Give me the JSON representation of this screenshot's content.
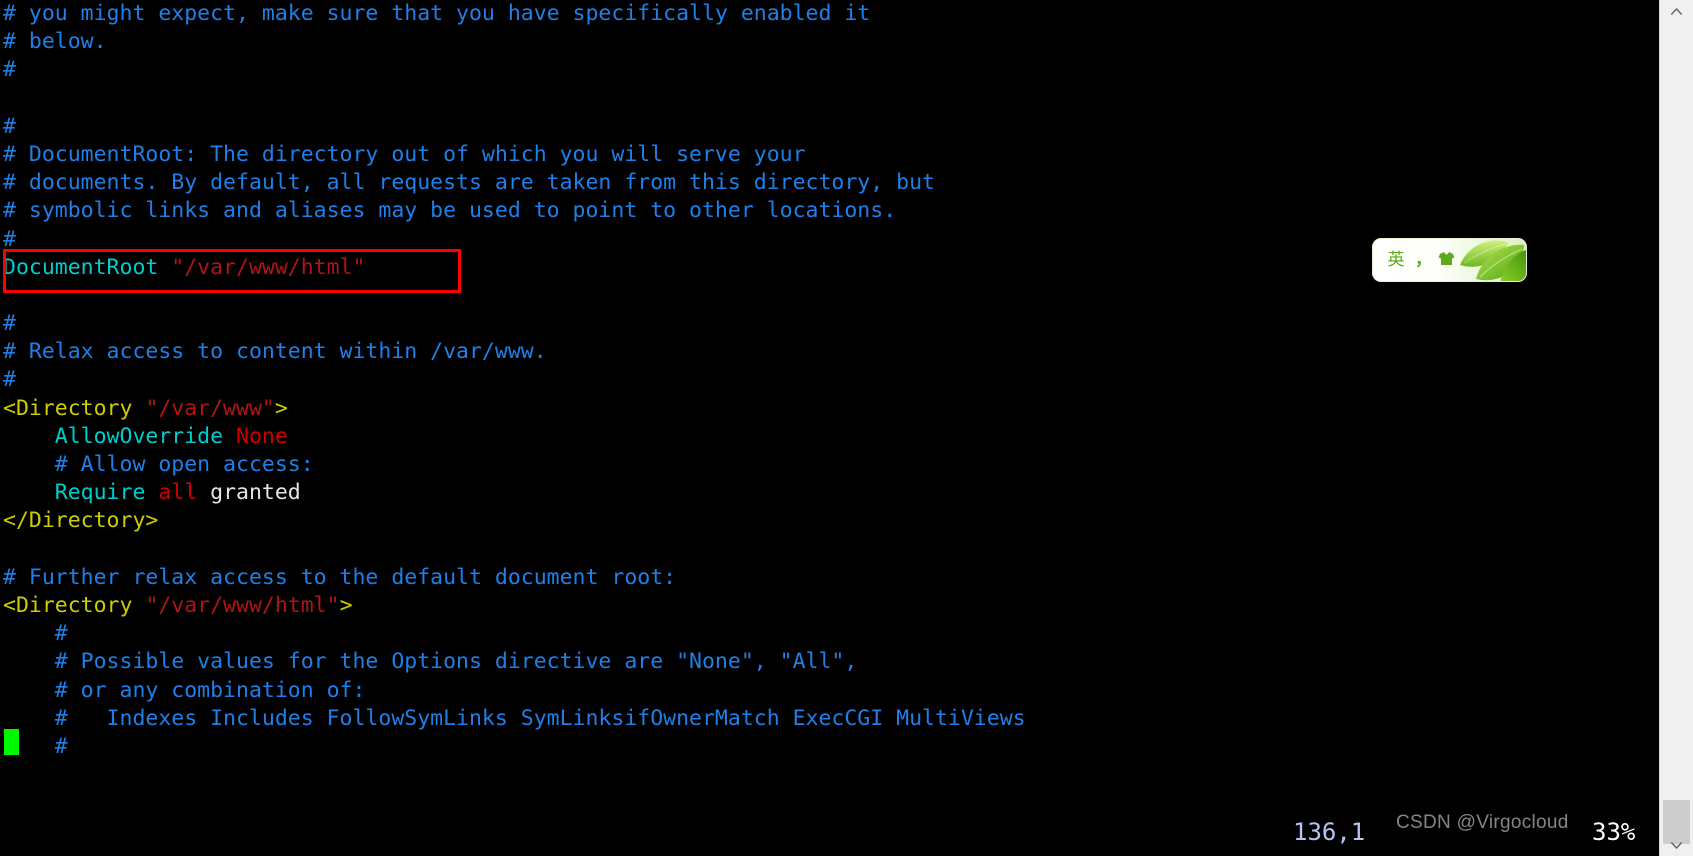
{
  "window": {
    "kind": "terminal-editor",
    "background_color": "#000000"
  },
  "editor": {
    "file_type": "apache-httpd-conf",
    "colors": {
      "comment": "#1f7fe8",
      "directive": "#00cdcd",
      "string": "#b01414",
      "value": "#cd0000",
      "tag": "#cdcd00",
      "plain": "#e6e6e6",
      "cursor": "#00f700",
      "highlight_box": "#ff0000"
    },
    "lines": [
      {
        "id": "l01",
        "segments": [
          {
            "style": "comment",
            "text": "# you might expect, make sure that you have specifically enabled it"
          }
        ]
      },
      {
        "id": "l02",
        "segments": [
          {
            "style": "comment",
            "text": "# below."
          }
        ]
      },
      {
        "id": "l03",
        "segments": [
          {
            "style": "comment",
            "text": "#"
          }
        ]
      },
      {
        "id": "l04",
        "segments": [
          {
            "style": "blank",
            "text": ""
          }
        ]
      },
      {
        "id": "l05",
        "segments": [
          {
            "style": "comment",
            "text": "#"
          }
        ]
      },
      {
        "id": "l06",
        "segments": [
          {
            "style": "comment",
            "text": "# DocumentRoot: The directory out of which you will serve your"
          }
        ]
      },
      {
        "id": "l07",
        "segments": [
          {
            "style": "comment",
            "text": "# documents. By default, all requests are taken from this directory, but"
          }
        ]
      },
      {
        "id": "l08",
        "segments": [
          {
            "style": "comment",
            "text": "# symbolic links and aliases may be used to point to other locations."
          }
        ]
      },
      {
        "id": "l09",
        "segments": [
          {
            "style": "comment",
            "text": "#"
          }
        ]
      },
      {
        "id": "l10",
        "segments": [
          {
            "style": "keyword",
            "text": "DocumentRoot "
          },
          {
            "style": "string",
            "text": "\"/var/www/html\""
          }
        ]
      },
      {
        "id": "l11",
        "segments": [
          {
            "style": "blank",
            "text": ""
          }
        ]
      },
      {
        "id": "l12",
        "segments": [
          {
            "style": "comment",
            "text": "#"
          }
        ]
      },
      {
        "id": "l13",
        "segments": [
          {
            "style": "comment",
            "text": "# Relax access to content within /var/www."
          }
        ]
      },
      {
        "id": "l14",
        "segments": [
          {
            "style": "comment",
            "text": "#"
          }
        ]
      },
      {
        "id": "l15",
        "segments": [
          {
            "style": "tag",
            "text": "<Directory "
          },
          {
            "style": "string",
            "text": "\"/var/www\""
          },
          {
            "style": "tag",
            "text": ">"
          }
        ]
      },
      {
        "id": "l16",
        "segments": [
          {
            "style": "keyword",
            "text": "    AllowOverride "
          },
          {
            "style": "value",
            "text": "None"
          }
        ]
      },
      {
        "id": "l17",
        "segments": [
          {
            "style": "comment",
            "text": "    # Allow open access:"
          }
        ]
      },
      {
        "id": "l18",
        "segments": [
          {
            "style": "keyword",
            "text": "    Require "
          },
          {
            "style": "value",
            "text": "all "
          },
          {
            "style": "plain",
            "text": "granted"
          }
        ]
      },
      {
        "id": "l19",
        "segments": [
          {
            "style": "tag",
            "text": "</Directory>"
          }
        ]
      },
      {
        "id": "l20",
        "segments": [
          {
            "style": "blank",
            "text": ""
          }
        ]
      },
      {
        "id": "l21",
        "segments": [
          {
            "style": "comment",
            "text": "# Further relax access to the default document root:"
          }
        ]
      },
      {
        "id": "l22",
        "segments": [
          {
            "style": "tag",
            "text": "<Directory "
          },
          {
            "style": "string",
            "text": "\"/var/www/html\""
          },
          {
            "style": "tag",
            "text": ">"
          }
        ]
      },
      {
        "id": "l23",
        "segments": [
          {
            "style": "comment",
            "text": "    #"
          }
        ]
      },
      {
        "id": "l24",
        "segments": [
          {
            "style": "comment",
            "text": "    # Possible values for the Options directive are \"None\", \"All\","
          }
        ]
      },
      {
        "id": "l25",
        "segments": [
          {
            "style": "comment",
            "text": "    # or any combination of:"
          }
        ]
      },
      {
        "id": "l26",
        "segments": [
          {
            "style": "comment",
            "text": "    #   Indexes Includes FollowSymLinks SymLinksifOwnerMatch ExecCGI MultiViews"
          }
        ]
      },
      {
        "id": "l27",
        "segments": [
          {
            "style": "comment",
            "text": "    #"
          }
        ]
      }
    ]
  },
  "status": {
    "ruler": "136,1",
    "percent": "33%"
  },
  "watermark": {
    "text": "CSDN @Virgocloud"
  },
  "ime": {
    "language_label": "英",
    "punctuation_label": "，",
    "skin_label": "",
    "tooltip": "input-method-toolbar"
  },
  "scrollbar": {
    "up_arrow": "︿",
    "down_arrow": "﹀"
  }
}
